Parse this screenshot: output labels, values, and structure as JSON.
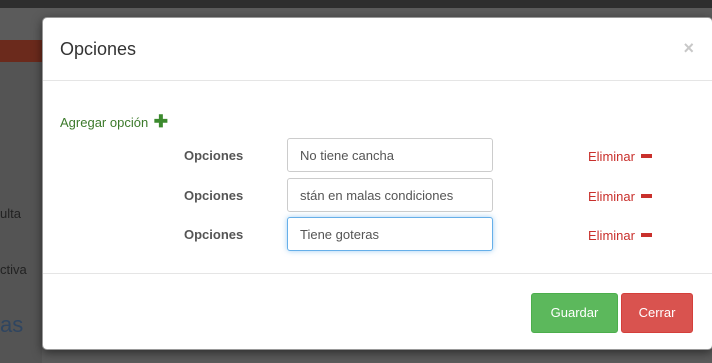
{
  "background": {
    "side_items": [
      "ulta",
      "ctiva"
    ],
    "side_big": "as"
  },
  "modal": {
    "title": "Opciones",
    "close_label": "×",
    "add_option_label": "Agregar opción",
    "rows": [
      {
        "label": "Opciones",
        "value": "No tiene cancha",
        "remove_label": "Eliminar"
      },
      {
        "label": "Opciones",
        "value": "stán en malas condiciones",
        "remove_label": "Eliminar"
      },
      {
        "label": "Opciones",
        "value": "Tiene goteras",
        "remove_label": "Eliminar"
      }
    ],
    "footer": {
      "save_label": "Guardar",
      "close_label": "Cerrar"
    }
  },
  "colors": {
    "save": "#5cb85c",
    "close": "#d9534f",
    "add": "#3c7a2b",
    "remove": "#c9302c"
  }
}
